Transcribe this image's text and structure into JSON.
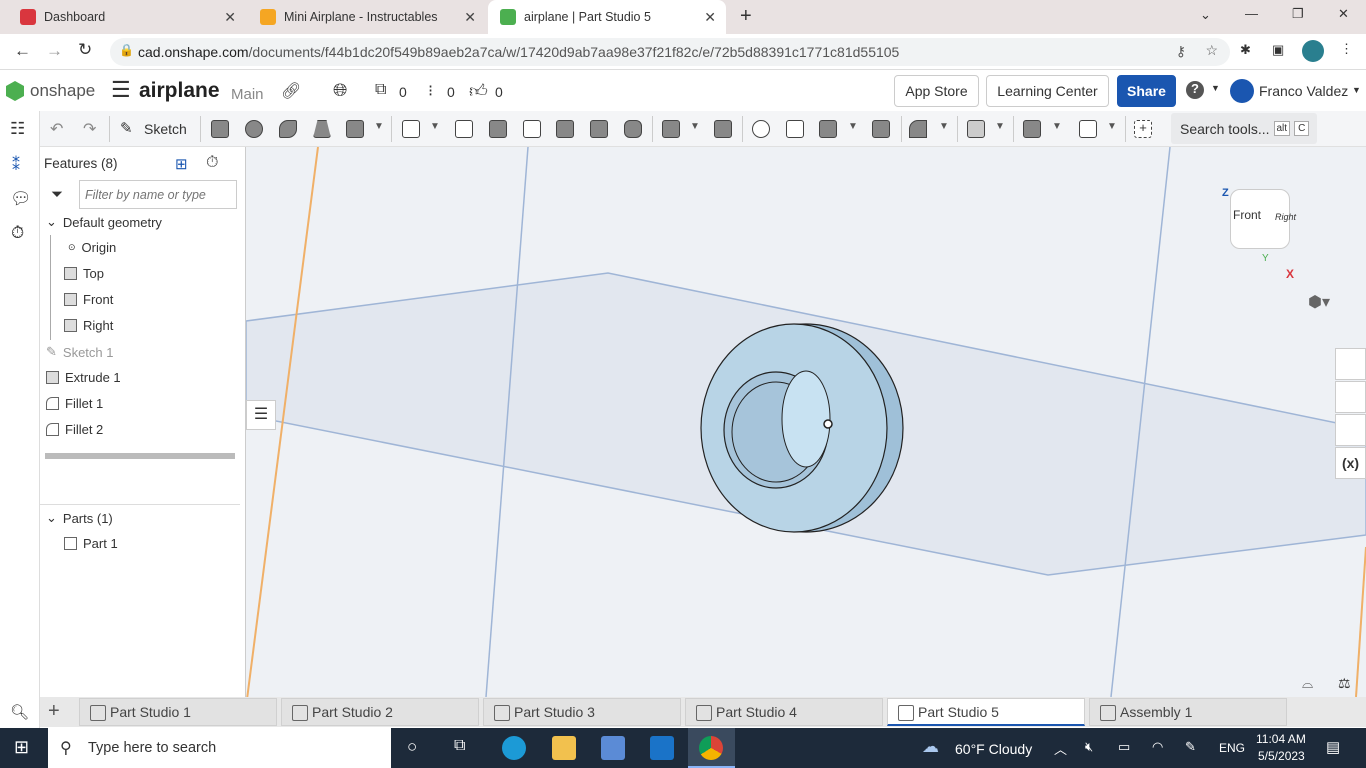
{
  "browser": {
    "tabs": [
      {
        "label": "Dashboard",
        "color": "#d9363e"
      },
      {
        "label": "Mini Airplane - Instructables",
        "color": "#f5a623"
      },
      {
        "label": "airplane | Part Studio 5",
        "color": "#4caf50"
      }
    ],
    "url_host": "cad.onshape.com",
    "url_path": "/documents/f44b1dc20f549b89aeb2a7ca/w/17420d9ab7aa98e37f21f82c/e/72b5d88391c1771c81d55105"
  },
  "header": {
    "brand": "onshape",
    "doc_title": "airplane",
    "branch": "Main",
    "versions_count": "0",
    "branches_count": "0",
    "likes_count": "0",
    "app_store": "App Store",
    "learning_center": "Learning Center",
    "share": "Share",
    "user": "Franco Valdez",
    "share_color": "#1a56b0"
  },
  "toolbar": {
    "sketch": "Sketch",
    "search": "Search tools...",
    "kbd1": "alt",
    "kbd2": "C"
  },
  "features": {
    "title": "Features (8)",
    "filter_placeholder": "Filter by name or type",
    "default_geometry": "Default geometry",
    "items": [
      "Origin",
      "Top",
      "Front",
      "Right",
      "Sketch 1",
      "Extrude 1",
      "Fillet 1",
      "Fillet 2"
    ],
    "parts_title": "Parts (1)",
    "parts": [
      "Part 1"
    ]
  },
  "viewcube": {
    "z": "Z",
    "y": "Y",
    "x": "X",
    "front": "Front",
    "right": "Right"
  },
  "bottom_tabs": [
    "Part Studio 1",
    "Part Studio 2",
    "Part Studio 3",
    "Part Studio 4",
    "Part Studio 5",
    "Assembly 1"
  ],
  "taskbar": {
    "search": "Type here to search",
    "weather": "60°F  Cloudy",
    "lang": "ENG",
    "time": "11:04 AM",
    "date": "5/5/2023"
  }
}
